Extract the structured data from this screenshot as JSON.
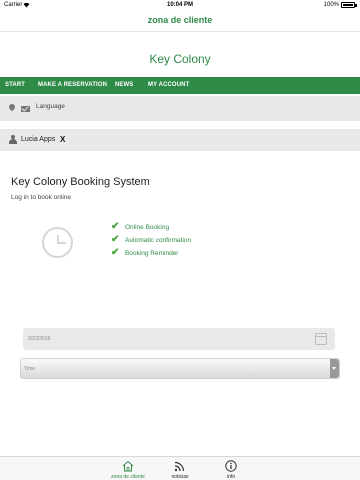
{
  "status_bar": {
    "carrier": "Carrier",
    "wifi_icon": "wifi-icon",
    "time": "10:04 PM",
    "battery": "100%"
  },
  "nav": {
    "title": "zona de cliente"
  },
  "brand": {
    "title": "Key Colony"
  },
  "menu": {
    "items": [
      {
        "label": "START"
      },
      {
        "label": "MAKE A RESERVATION"
      },
      {
        "label": "NEWS"
      },
      {
        "label": "MY ACCOUNT"
      }
    ]
  },
  "language_bar": {
    "icons": [
      "location-pin-icon",
      "mail-icon"
    ],
    "label": "Language"
  },
  "user_bar": {
    "icon": "user-icon",
    "name": "Lucia Apps",
    "logout": "X"
  },
  "booking": {
    "title": "Key Colony Booking System",
    "subtitle": "Log in to book online",
    "clock_icon": "clock-icon",
    "features": [
      {
        "icon": "checkmark-icon",
        "label": "Online Booking"
      },
      {
        "icon": "checkmark-icon",
        "label": "Automatic confirmation"
      },
      {
        "icon": "checkmark-icon",
        "label": "Booking Reminder"
      }
    ]
  },
  "form": {
    "date_value": "2/23/2016",
    "calendar_icon": "calendar-icon",
    "time_placeholder": "Time",
    "dropdown_icon": "dropdown-arrow-icon"
  },
  "tab_bar": {
    "tabs": [
      {
        "icon": "home-icon",
        "label": "zona de cliente",
        "active": true
      },
      {
        "icon": "rss-icon",
        "label": "noticias",
        "active": false
      },
      {
        "icon": "info-icon",
        "label": "info",
        "active": false
      }
    ]
  },
  "colors": {
    "brand_green": "#2e8a47",
    "check_green": "#4aa843",
    "panel_gray": "#e8e8e8"
  }
}
